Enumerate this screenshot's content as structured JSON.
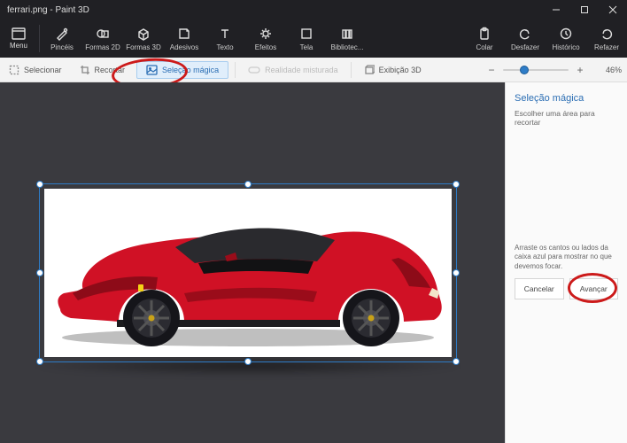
{
  "app": {
    "document_name": "ferrari.png",
    "app_name": "Paint 3D"
  },
  "titlebar": {
    "combined": "ferrari.png - Paint 3D"
  },
  "ribbon": {
    "menu": "Menu",
    "tools": [
      {
        "id": "brush",
        "label": "Pincéis"
      },
      {
        "id": "shapes2d",
        "label": "Formas 2D"
      },
      {
        "id": "shapes3d",
        "label": "Formas 3D"
      },
      {
        "id": "stickers",
        "label": "Adesivos"
      },
      {
        "id": "text",
        "label": "Texto"
      },
      {
        "id": "effects",
        "label": "Efeitos"
      },
      {
        "id": "canvas",
        "label": "Tela"
      },
      {
        "id": "library",
        "label": "Bibliotec..."
      }
    ],
    "actions": {
      "paste": "Colar",
      "undo": "Desfazer",
      "history": "Histórico",
      "redo": "Refazer"
    }
  },
  "subbar": {
    "select": "Selecionar",
    "crop": "Recortar",
    "magic_select": "Seleção mágica",
    "mixed_reality": "Realidade misturada",
    "view3d": "Exibição 3D",
    "zoom": {
      "value": "46%",
      "thumb_pct": 28
    }
  },
  "panel": {
    "title": "Seleção mágica",
    "subtitle": "Escolher uma área para recortar",
    "hint": "Arraste os cantos ou lados da caixa azul para mostrar no que devemos focar.",
    "cancel": "Cancelar",
    "next": "Avançar"
  },
  "colors": {
    "accent": "#2e7cc7",
    "ribbon_bg": "#202024",
    "canvas_bg": "#3a3a3f",
    "annotation": "#cc1a1a",
    "car_body": "#d01125"
  },
  "canvas": {
    "image_object": "red sports car (Ferrari), side view",
    "selection_active": true
  }
}
